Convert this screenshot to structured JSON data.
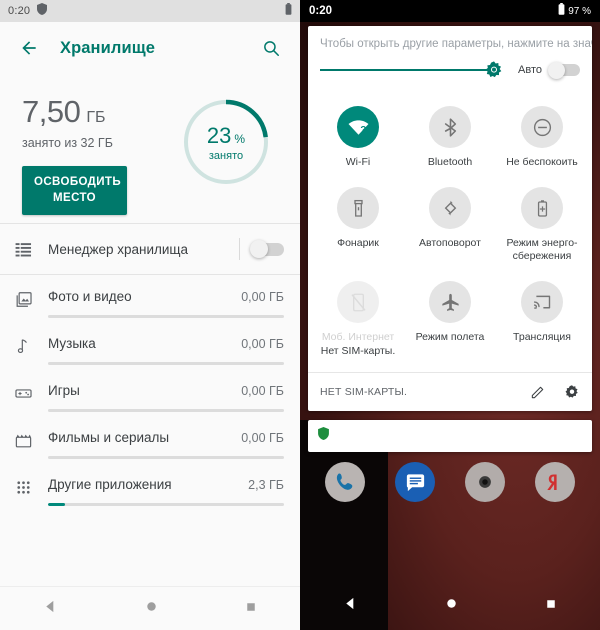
{
  "left": {
    "statusbar": {
      "clock": "0:20",
      "shield_icon": "shield-icon",
      "battery_icon": "battery-icon"
    },
    "appbar": {
      "back_icon": "back-arrow-icon",
      "title": "Хранилище",
      "search_icon": "search-icon",
      "accent_color": "#00796b"
    },
    "summary": {
      "used_value": "7,50",
      "used_unit": "ГБ",
      "subtitle": "занято из 32 ГБ",
      "free_button_label": "ОСВОБОДИТЬ МЕСТО",
      "donut": {
        "percent": "23",
        "percent_sign": "%",
        "label": "занято",
        "fill_fraction": 0.23,
        "arc_color": "#00796b",
        "track_color": "#cfe3e0"
      }
    },
    "manager_row": {
      "label": "Менеджер хранилища",
      "toggle_on": false,
      "icon": "list-lines-icon"
    },
    "categories": [
      {
        "label": "Фото и видео",
        "value": "0,00 ГБ",
        "fill": 0,
        "icon": "photo-icon"
      },
      {
        "label": "Музыка",
        "value": "0,00 ГБ",
        "fill": 0,
        "icon": "music-note-icon"
      },
      {
        "label": "Игры",
        "value": "0,00 ГБ",
        "fill": 0,
        "icon": "gamepad-icon"
      },
      {
        "label": "Фильмы и сериалы",
        "value": "0,00 ГБ",
        "fill": 0,
        "icon": "clapperboard-icon"
      },
      {
        "label": "Другие приложения",
        "value": "2,3 ГБ",
        "fill": 0.072,
        "icon": "apps-grid-icon"
      }
    ],
    "navbar": {
      "back_icon": "nav-back-icon",
      "home_icon": "nav-home-icon",
      "recents_icon": "nav-recents-icon"
    }
  },
  "right": {
    "statusbar": {
      "clock": "0:20",
      "battery_icon": "battery-icon",
      "battery_percent": "97 %"
    },
    "shade": {
      "hint": "Чтобы открыть другие параметры, нажмите на значок и",
      "brightness": {
        "slider_icon": "brightness-sun-icon",
        "fill_fraction": 0.93,
        "auto_label": "Авто",
        "auto_on": false
      },
      "tiles": [
        {
          "label": "Wi-Fi",
          "icon": "wifi-question-icon",
          "state": "active"
        },
        {
          "label": "Bluetooth",
          "icon": "bluetooth-icon",
          "state": "inactive"
        },
        {
          "label": "Не беспокоить",
          "icon": "do-not-disturb-icon",
          "state": "inactive"
        },
        {
          "label": "Фонарик",
          "icon": "flashlight-icon",
          "state": "inactive"
        },
        {
          "label": "Автоповорот",
          "icon": "auto-rotate-icon",
          "state": "inactive"
        },
        {
          "label": "Режим энерго-сбережения",
          "icon": "battery-saver-icon",
          "state": "inactive"
        },
        {
          "label": "Моб. Интернет",
          "icon": "mobile-data-off-icon",
          "state": "disabled",
          "sublabel": "Нет SIM-карты."
        },
        {
          "label": "Режим полета",
          "icon": "airplane-icon",
          "state": "inactive"
        },
        {
          "label": "Трансляция",
          "icon": "cast-icon",
          "state": "inactive"
        }
      ],
      "footer": {
        "sim_text": "НЕТ SIM-КАРТЫ.",
        "edit_icon": "pencil-icon",
        "settings_icon": "gear-icon"
      }
    },
    "notification": {
      "icon": "green-shield-icon",
      "icon_color": "#1e8e3e"
    },
    "dock": [
      {
        "name": "Телефон",
        "icon": "phone-icon"
      },
      {
        "name": "Сообщения",
        "icon": "messages-icon"
      },
      {
        "name": "Камера",
        "icon": "camera-icon"
      },
      {
        "name": "Яндекс",
        "icon": "yandex-icon"
      }
    ],
    "navbar": {
      "back_icon": "nav-back-icon",
      "home_icon": "nav-home-icon",
      "recents_icon": "nav-recents-icon"
    }
  }
}
